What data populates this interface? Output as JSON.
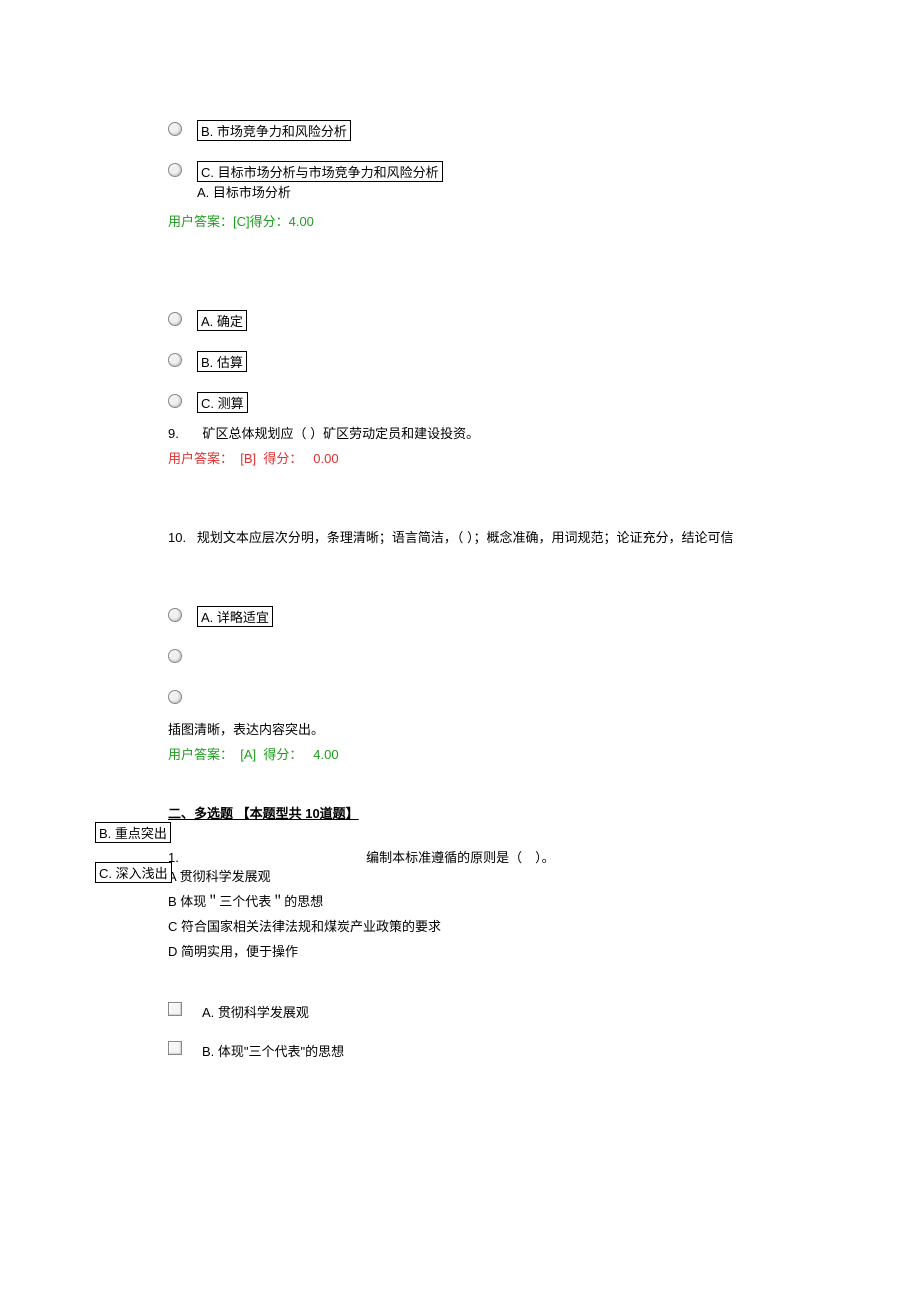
{
  "q8": {
    "optB": "B. 市场竞争力和风险分析",
    "optC": "C. 目标市场分析与市场竞争力和风险分析",
    "optA_below": "A. 目标市场分析",
    "answer": "用户答案：[C]得分：4.00"
  },
  "q9": {
    "optA": "A. 确定",
    "optB": "B. 估算",
    "optC": "C. 测算",
    "qline_num": "9.",
    "qline_text": "矿区总体规划应（ ）矿区劳动定员和建设投资。",
    "answer_prefix": "用户答案：",
    "answer_val": "[B]",
    "answer_score_label": "得分：",
    "answer_score": "0.00"
  },
  "q10": {
    "qnum": "10.",
    "qtext": "规划文本应层次分明，条理清晰；语言简洁，（ ）；概念准确，用词规范；论证充分，结论可信",
    "optA": "A. 详略适宜",
    "tail_text": "插图清晰，表达内容突出。",
    "answer_prefix": "用户答案：",
    "answer_val": "[A]",
    "answer_score_label": "得分：",
    "answer_score": "4.00"
  },
  "section2": {
    "heading": "二、多选题 【本题型共 10道题】",
    "floatB": "B. 重点突出",
    "floatC": "C. 深入浅出",
    "q1_num": "1.",
    "q1_text": "编制本标准遵循的原则是（　）。",
    "lineA": "A 贯彻科学发展观",
    "lineB": "B 体现＂三个代表＂的思想",
    "lineC": "C 符合国家相关法律法规和煤炭产业政策的要求",
    "lineD": "D 简明实用，便于操作",
    "checkA": "A. 贯彻科学发展观",
    "checkB": "B. 体现\"三个代表\"的思想"
  }
}
